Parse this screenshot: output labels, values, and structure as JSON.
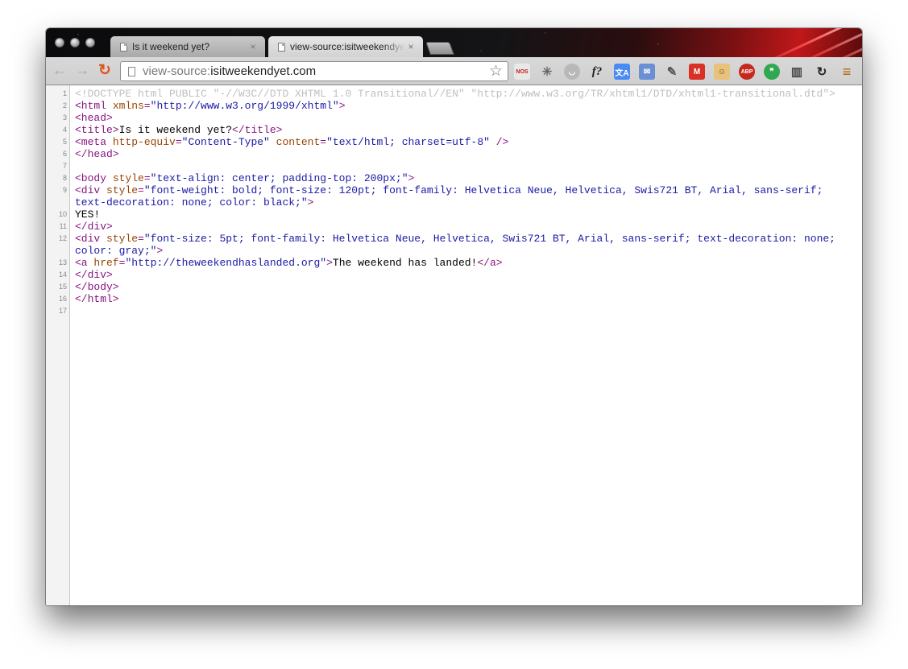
{
  "window": {
    "tabs": [
      {
        "title": "Is it weekend yet?",
        "close": "×",
        "active": false
      },
      {
        "title": "view-source:isitweekendyet.com",
        "close": "×",
        "active": true
      }
    ]
  },
  "toolbar": {
    "back_icon": "←",
    "forward_icon": "→",
    "reload_icon": "↻",
    "url_scheme": "view-source:",
    "url_host": "isitweekendyet.com",
    "star_icon": "☆",
    "extensions": [
      {
        "name": "nos-news-extension",
        "label": "NOS",
        "color": "#e8e8e8",
        "text_color": "#c21a1a"
      },
      {
        "name": "loading-spinner-icon",
        "label": "✳",
        "color": "#cfcfcf",
        "text_color": "#666666"
      },
      {
        "name": "pocket-extension",
        "label": "◡",
        "color": "#b8b8b8",
        "text_color": "#ffffff"
      },
      {
        "name": "whatfont-extension",
        "label": "f?",
        "color": "#cfcfcf",
        "text_color": "#222222"
      },
      {
        "name": "translate-extension",
        "label": "文A",
        "color": "#4a8af4",
        "text_color": "#ffffff"
      },
      {
        "name": "mail-extension",
        "label": "✉",
        "color": "#6b8fd4",
        "text_color": "#ffffff"
      },
      {
        "name": "eyedropper-extension",
        "label": "✎",
        "color": "#cfcfcf",
        "text_color": "#555555"
      },
      {
        "name": "gmail-extension",
        "label": "M",
        "color": "#d93025",
        "text_color": "#ffffff"
      },
      {
        "name": "face-extension",
        "label": "☺",
        "color": "#e8c27a",
        "text_color": "#6a3a1a"
      },
      {
        "name": "adblock-plus-extension",
        "label": "ABP",
        "color": "#c7281e",
        "text_color": "#ffffff"
      },
      {
        "name": "hangouts-extension",
        "label": "❞",
        "color": "#2fa84f",
        "text_color": "#ffffff"
      },
      {
        "name": "reader-extension",
        "label": "▥",
        "color": "#cfcfcf",
        "text_color": "#444444"
      },
      {
        "name": "sync-extension",
        "label": "↻",
        "color": "#cfcfcf",
        "text_color": "#222222"
      },
      {
        "name": "menu-icon",
        "label": "≡",
        "color": "#cfcfcf",
        "text_color": "#b25a00"
      }
    ]
  },
  "source": {
    "lines": [
      {
        "n": "1",
        "parts": [
          [
            "doctype",
            "<!DOCTYPE html PUBLIC \"-//W3C//DTD XHTML 1.0 Transitional//EN\" \"http://www.w3.org/TR/xhtml1/DTD/xhtml1-transitional.dtd\">"
          ]
        ]
      },
      {
        "n": "2",
        "parts": [
          [
            "tag",
            "<html "
          ],
          [
            "attr",
            "xmlns"
          ],
          [
            "tag",
            "="
          ],
          [
            "val",
            "\"http://www.w3.org/1999/xhtml\""
          ],
          [
            "tag",
            ">"
          ]
        ]
      },
      {
        "n": "3",
        "parts": [
          [
            "tag",
            "<head>"
          ]
        ]
      },
      {
        "n": "4",
        "parts": [
          [
            "tag",
            "<title>"
          ],
          [
            "text",
            "Is it weekend yet?"
          ],
          [
            "tag",
            "</title>"
          ]
        ]
      },
      {
        "n": "5",
        "parts": [
          [
            "tag",
            "<meta "
          ],
          [
            "attr",
            "http-equiv"
          ],
          [
            "tag",
            "="
          ],
          [
            "val",
            "\"Content-Type\""
          ],
          [
            "text",
            " "
          ],
          [
            "attr",
            "content"
          ],
          [
            "tag",
            "="
          ],
          [
            "val",
            "\"text/html; charset=utf-8\""
          ],
          [
            "tag",
            " />"
          ]
        ]
      },
      {
        "n": "6",
        "parts": [
          [
            "tag",
            "</head>"
          ]
        ]
      },
      {
        "n": "7",
        "parts": []
      },
      {
        "n": "8",
        "parts": [
          [
            "tag",
            "<body "
          ],
          [
            "attr",
            "style"
          ],
          [
            "tag",
            "="
          ],
          [
            "val",
            "\"text-align: center; padding-top: 200px;\""
          ],
          [
            "tag",
            ">"
          ]
        ]
      },
      {
        "n": "9",
        "parts": [
          [
            "tag",
            "<div "
          ],
          [
            "attr",
            "style"
          ],
          [
            "tag",
            "="
          ],
          [
            "val",
            "\"font-weight: bold; font-size: 120pt; font-family: Helvetica Neue, Helvetica, Swis721 BT, Arial, sans-serif;"
          ]
        ]
      },
      {
        "n": "",
        "parts": [
          [
            "val",
            "text-decoration: none; color: black;\""
          ],
          [
            "tag",
            ">"
          ]
        ]
      },
      {
        "n": "10",
        "parts": [
          [
            "text",
            "YES!"
          ]
        ]
      },
      {
        "n": "11",
        "parts": [
          [
            "tag",
            "</div>"
          ]
        ]
      },
      {
        "n": "12",
        "parts": [
          [
            "tag",
            "<div "
          ],
          [
            "attr",
            "style"
          ],
          [
            "tag",
            "="
          ],
          [
            "val",
            "\"font-size: 5pt; font-family: Helvetica Neue, Helvetica, Swis721 BT, Arial, sans-serif; text-decoration: none;"
          ]
        ]
      },
      {
        "n": "",
        "parts": [
          [
            "val",
            "color: gray;\""
          ],
          [
            "tag",
            ">"
          ]
        ]
      },
      {
        "n": "13",
        "parts": [
          [
            "tag",
            "<a "
          ],
          [
            "attr",
            "href"
          ],
          [
            "tag",
            "="
          ],
          [
            "val",
            "\""
          ],
          [
            "link",
            "http://theweekendhaslanded.org"
          ],
          [
            "val",
            "\""
          ],
          [
            "tag",
            ">"
          ],
          [
            "text",
            "The weekend has landed!"
          ],
          [
            "tag",
            "</a>"
          ]
        ]
      },
      {
        "n": "14",
        "parts": [
          [
            "tag",
            "</div>"
          ]
        ]
      },
      {
        "n": "15",
        "parts": [
          [
            "tag",
            "</body>"
          ]
        ]
      },
      {
        "n": "16",
        "parts": [
          [
            "tag",
            "</html>"
          ]
        ]
      },
      {
        "n": "17",
        "parts": []
      }
    ]
  }
}
